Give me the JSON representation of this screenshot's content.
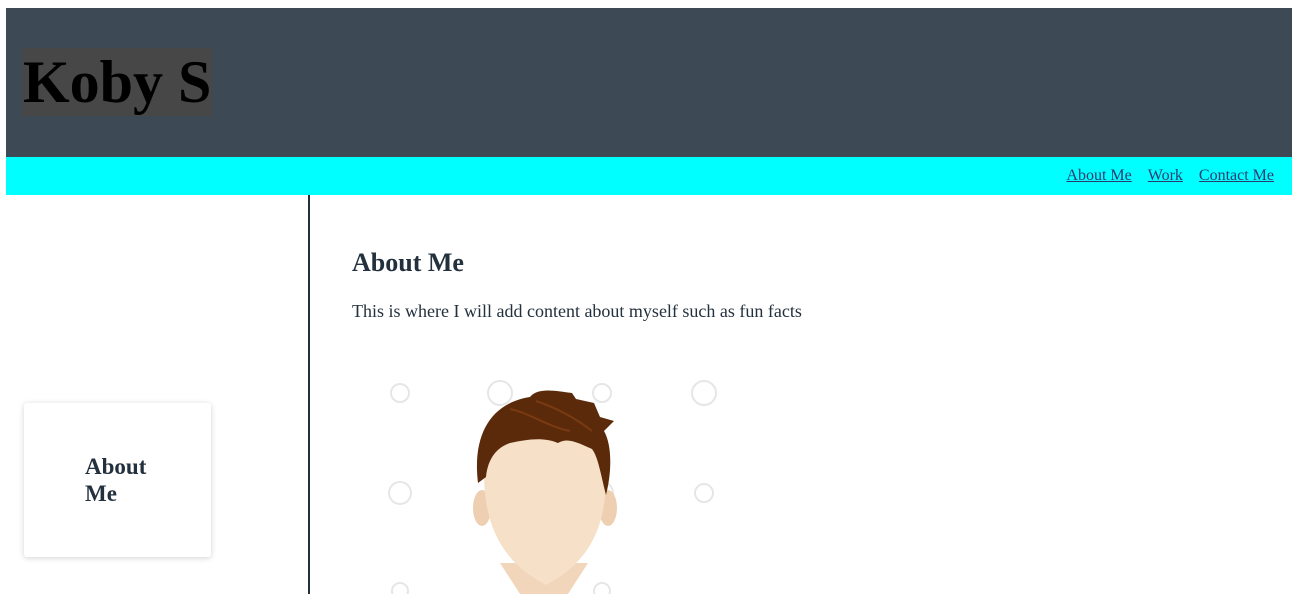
{
  "header": {
    "site_title": "Koby S",
    "background_color": "#3d4a55"
  },
  "nav": {
    "background_color": "#00ffff",
    "links": [
      {
        "label": "About Me"
      },
      {
        "label": "Work"
      },
      {
        "label": "Contact Me"
      }
    ]
  },
  "sidebar": {
    "card_title": "About Me"
  },
  "main": {
    "section_title": "About Me",
    "section_text": "This is where I will add content about myself such as fun facts",
    "portrait_icon": "avatar-illustration"
  }
}
